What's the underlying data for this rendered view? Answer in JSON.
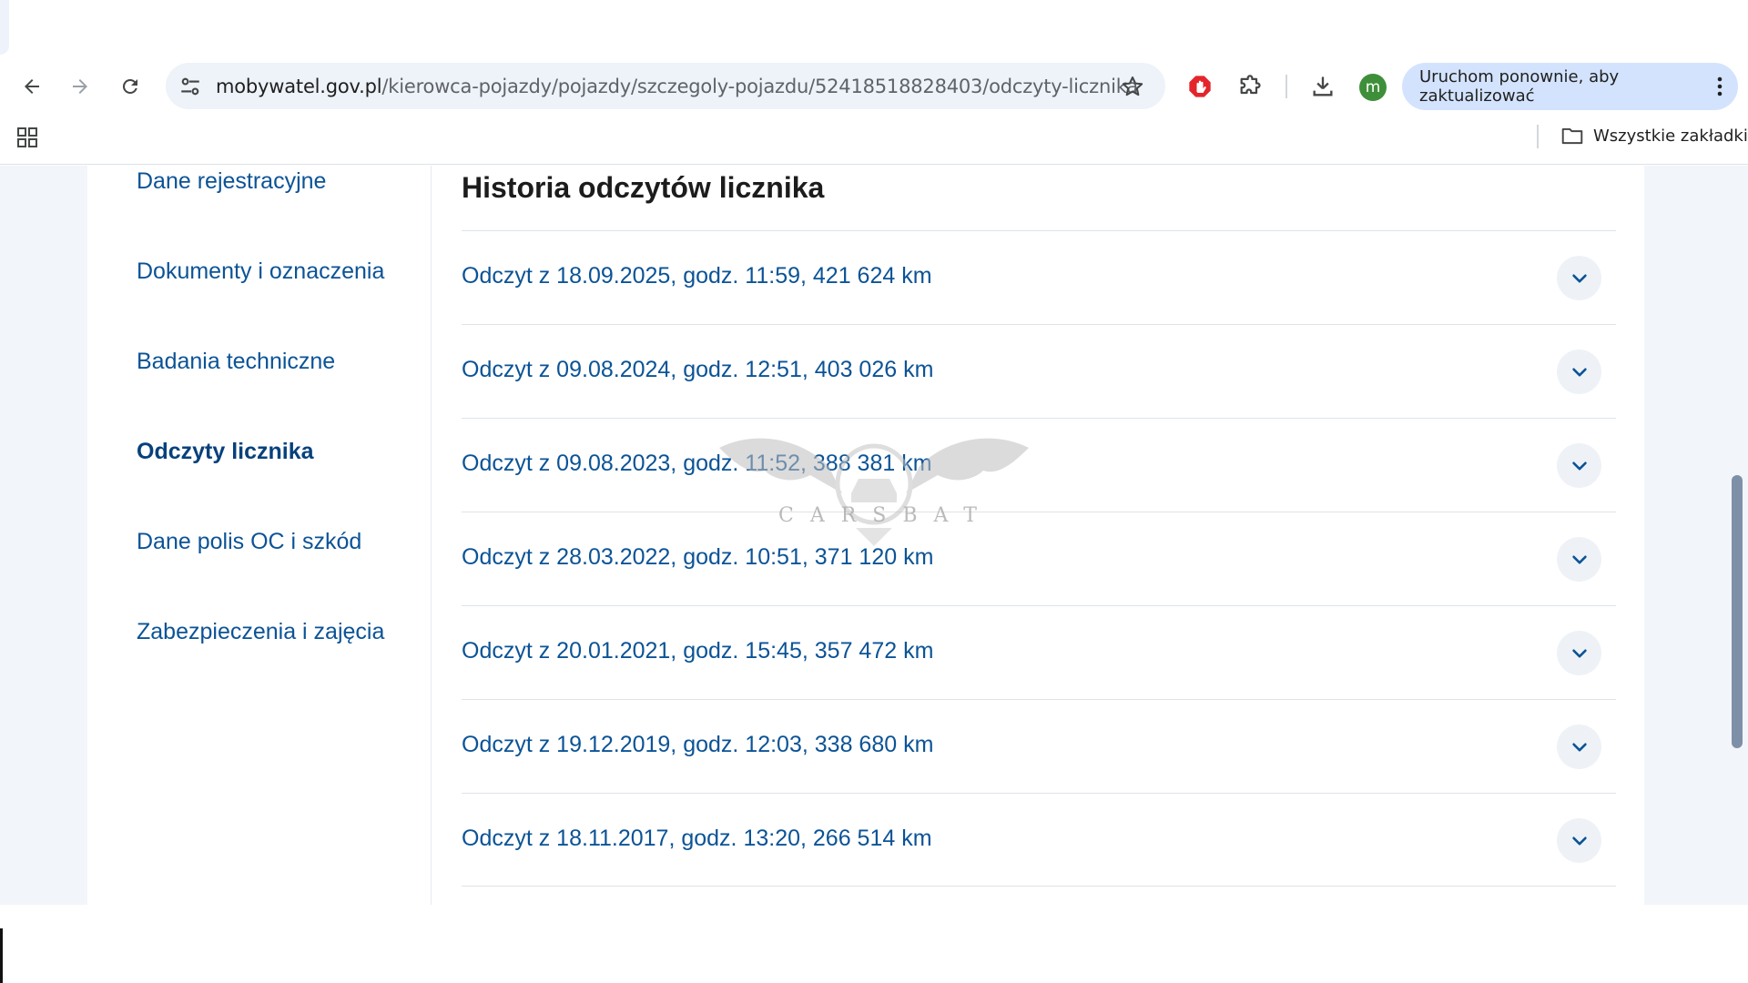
{
  "browser": {
    "url_host": "mobywatel.gov.pl",
    "url_path": "/kierowca-pojazdy/pojazdy/szczegoly-pojazdu/52418518828403/odczyty-licznika",
    "avatar_letter": "m",
    "update_button": "Uruchom ponownie, aby zaktualizować",
    "all_bookmarks": "Wszystkie zakładki"
  },
  "sidebar": {
    "items": [
      {
        "label": "Dane rejestracyjne",
        "active": false
      },
      {
        "label": "Dokumenty i oznaczenia",
        "active": false
      },
      {
        "label": "Badania techniczne",
        "active": false
      },
      {
        "label": "Odczyty licznika",
        "active": true
      },
      {
        "label": "Dane polis OC i szkód",
        "active": false
      },
      {
        "label": "Zabezpieczenia i zajęcia",
        "active": false
      }
    ]
  },
  "main": {
    "title": "Historia odczytów licznika",
    "readings": [
      "Odczyt z 18.09.2025, godz. 11:59, 421 624 km",
      "Odczyt z 09.08.2024, godz. 12:51, 403 026 km",
      "Odczyt z 09.08.2023, godz. 11:52, 388 381 km",
      "Odczyt z 28.03.2022, godz. 10:51, 371 120 km",
      "Odczyt z 20.01.2021, godz. 15:45, 357 472 km",
      "Odczyt z 19.12.2019, godz. 12:03, 338 680 km",
      "Odczyt z 18.11.2017, godz. 13:20, 266 514 km"
    ]
  },
  "watermark": {
    "text": "CARSBAT"
  },
  "colors": {
    "link": "#0b5396",
    "active_link": "#07417c",
    "page_bg": "#f2f5fa",
    "update_button_bg": "#d3e3fd"
  },
  "icons": [
    "back-arrow-icon",
    "forward-arrow-icon",
    "reload-icon",
    "site-settings-icon",
    "star-icon",
    "adblock-icon",
    "extensions-icon",
    "download-icon",
    "kebab-menu-icon",
    "apps-grid-icon",
    "folder-icon",
    "chevron-down-icon"
  ]
}
